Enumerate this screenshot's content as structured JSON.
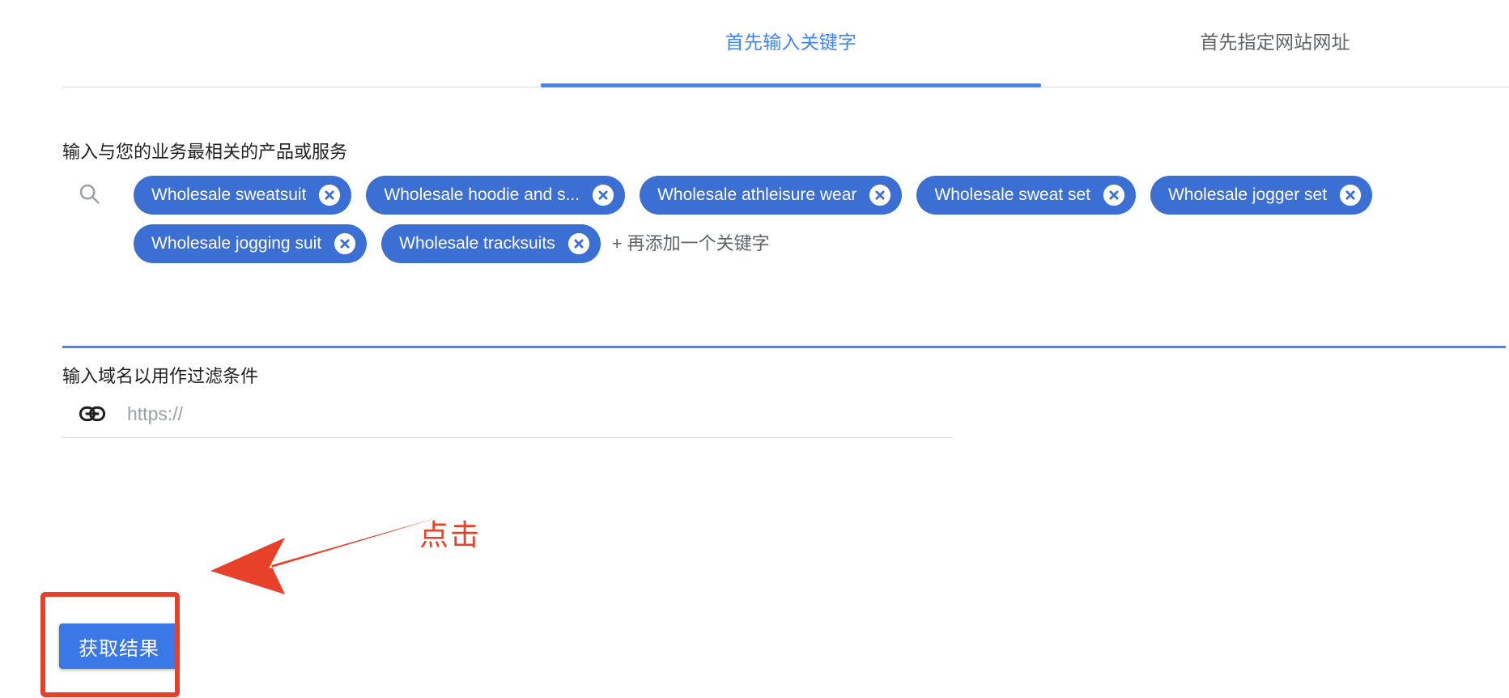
{
  "tabs": [
    {
      "label": "首先输入关键字",
      "active": true
    },
    {
      "label": "首先指定网站网址",
      "active": false
    }
  ],
  "keywords_section": {
    "label": "输入与您的业务最相关的产品或服务",
    "search_icon": "search-icon",
    "chips": [
      "Wholesale sweatsuit",
      "Wholesale hoodie and s...",
      "Wholesale athleisure wear",
      "Wholesale sweat set",
      "Wholesale jogger set",
      "Wholesale jogging suit",
      "Wholesale tracksuits"
    ],
    "add_more_text": "+ 再添加一个关键字",
    "chip_color": "#3b6fd4",
    "underline_color": "#4285f4"
  },
  "domain_section": {
    "label": "输入域名以用作过滤条件",
    "link_icon": "link-icon",
    "input_value": "",
    "placeholder": "https://"
  },
  "submit": {
    "label": "获取结果",
    "color": "#3b78e7"
  },
  "annotation": {
    "text": "点击",
    "color": "#e8412a"
  }
}
